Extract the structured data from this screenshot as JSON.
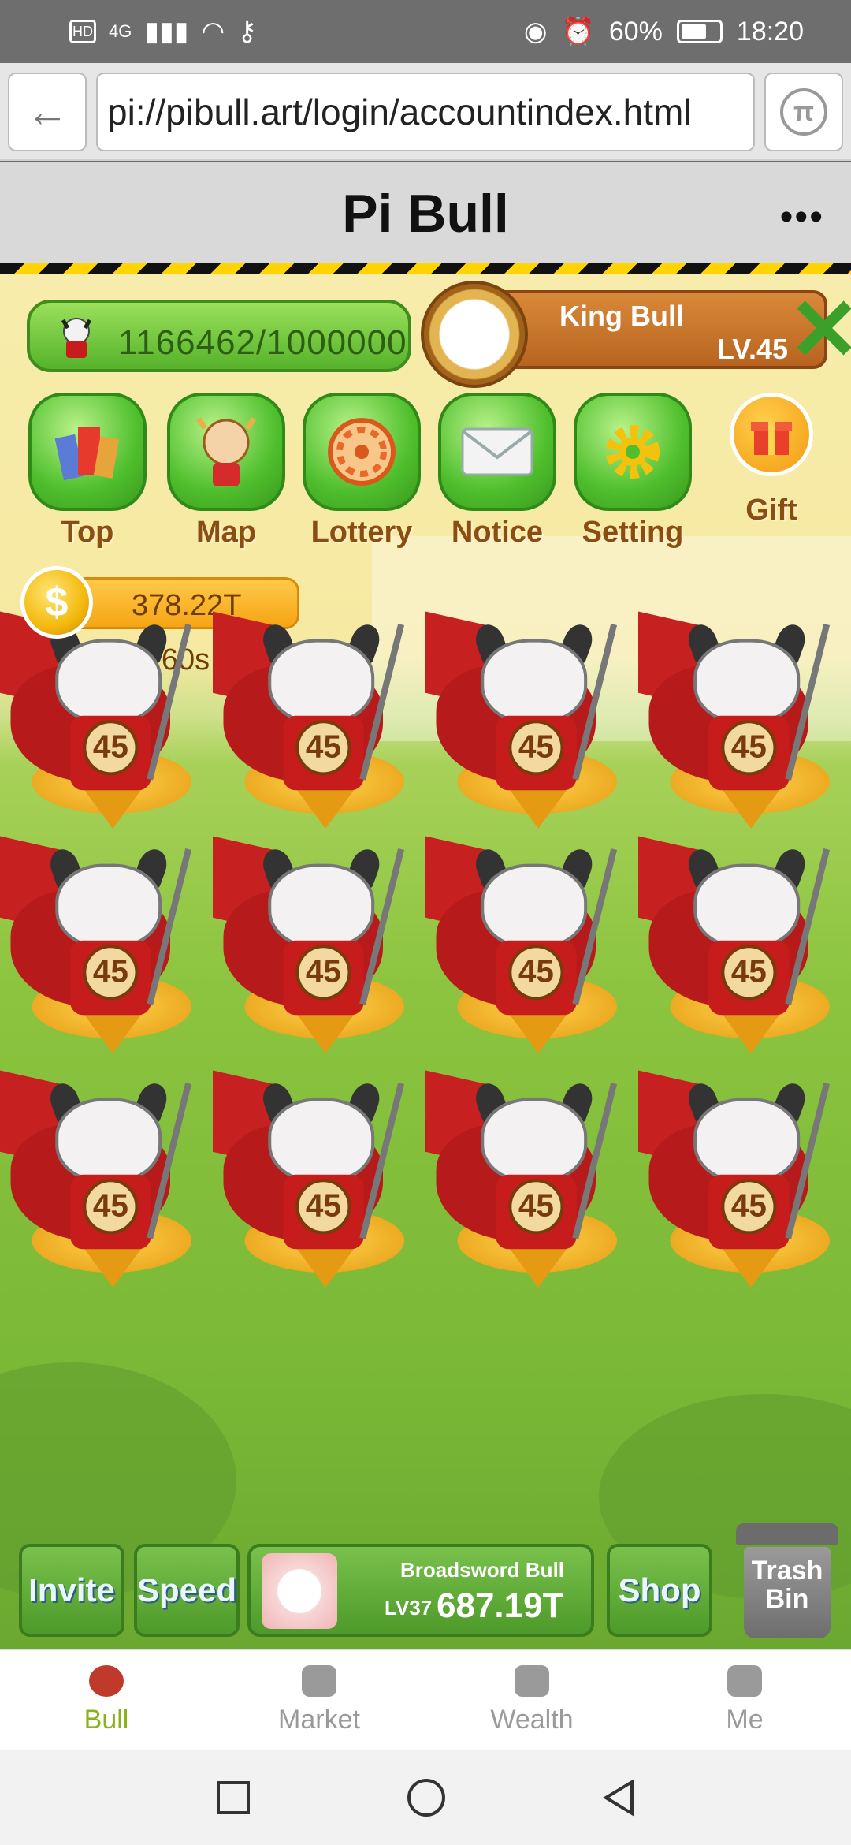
{
  "status_bar": {
    "left_labels": [
      "HD",
      "4G"
    ],
    "battery": "60%",
    "time": "18:20"
  },
  "browser": {
    "url": "pi://pibull.art/login/accountindex.html"
  },
  "app": {
    "title": "Pi Bull",
    "more_label": "•••"
  },
  "game": {
    "capacity": "1166462/1000000",
    "king": {
      "name": "King Bull",
      "level": "LV.45"
    },
    "menu": [
      {
        "label": "Top"
      },
      {
        "label": "Map"
      },
      {
        "label": "Lottery"
      },
      {
        "label": "Notice"
      },
      {
        "label": "Setting"
      },
      {
        "label": "Gift"
      }
    ],
    "coins": {
      "symbol": "$",
      "amount": "378.22T",
      "timer": "47/60s"
    },
    "bull_level": "45",
    "bull_count": 12
  },
  "actions": {
    "invite": "Invite",
    "speed": "Speed",
    "buy": {
      "name": "Broadsword Bull",
      "level": "LV37",
      "price": "687.19T"
    },
    "shop": "Shop",
    "trash": "Trash Bin"
  },
  "bottom_nav": [
    {
      "label": "Bull",
      "icon": "bull-icon",
      "active": true
    },
    {
      "label": "Market",
      "icon": "store-icon",
      "active": false
    },
    {
      "label": "Wealth",
      "icon": "money-bag-icon",
      "active": false
    },
    {
      "label": "Me",
      "icon": "user-icon",
      "active": false
    }
  ],
  "colors": {
    "accent_green": "#8ab21c",
    "hazard_yellow": "#ffd400"
  }
}
